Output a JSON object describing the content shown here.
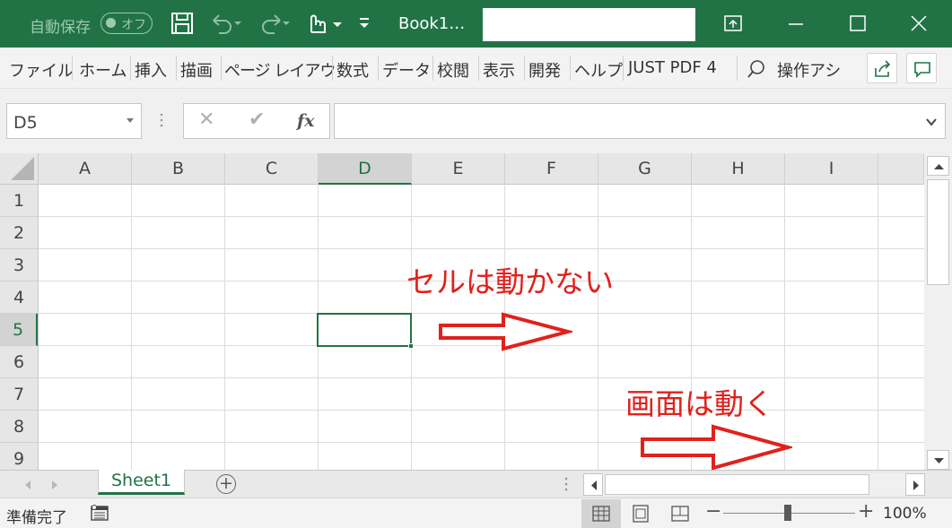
{
  "titlebar": {
    "autosave_label": "自動保存",
    "autosave_state": "オフ",
    "book_title": "Book1…",
    "save_icon": "save-icon",
    "undo_icon": "undo-icon",
    "redo_icon": "redo-icon",
    "touch_icon": "touch-mode-icon",
    "accent": "#217346"
  },
  "ribbon": {
    "tabs": [
      "ファイル",
      "ホーム",
      "挿入",
      "描画",
      "ページ レイアウ",
      "数式",
      "データ",
      "校閲",
      "表示",
      "開発",
      "ヘルプ",
      "JUST PDF 4"
    ],
    "tell_me": "操作アシ"
  },
  "formula_bar": {
    "name_box": "D5",
    "cancel_symbol": "✕",
    "enter_symbol": "✔",
    "fx_label": "fx",
    "formula": ""
  },
  "grid": {
    "columns": [
      "A",
      "B",
      "C",
      "D",
      "E",
      "F",
      "G",
      "H",
      "I"
    ],
    "rows": [
      "1",
      "2",
      "3",
      "4",
      "5",
      "6",
      "7",
      "8",
      "9"
    ],
    "selected_column": "D",
    "selected_row": "5"
  },
  "annotations": {
    "cells_stay": "セルは動かない",
    "screen_moves": "画面は動く",
    "color": "#e0211c"
  },
  "sheets": {
    "tabs": [
      "Sheet1"
    ],
    "active": "Sheet1",
    "add_symbol": "+"
  },
  "statusbar": {
    "status": "準備完了",
    "zoom_minus": "−",
    "zoom_plus": "+",
    "zoom": "100%"
  }
}
